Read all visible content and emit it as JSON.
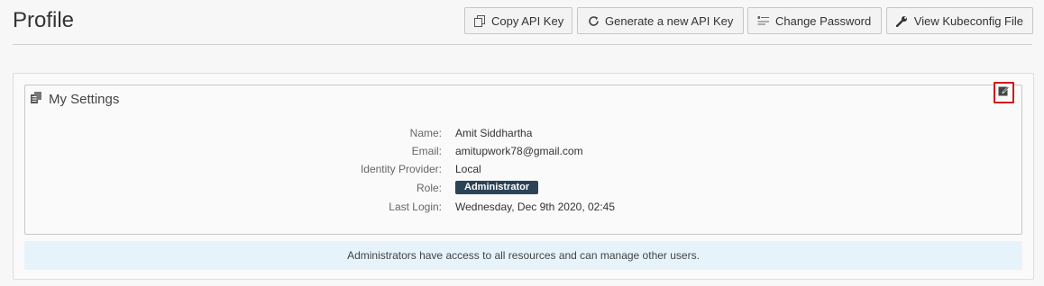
{
  "header": {
    "title": "Profile",
    "buttons": {
      "copy_api_key": "Copy API Key",
      "generate_api_key": "Generate a new API Key",
      "change_password": "Change Password",
      "view_kubeconfig": "View Kubeconfig File"
    }
  },
  "settings": {
    "title": "My Settings",
    "fields": {
      "name_label": "Name:",
      "name_value": "Amit Siddhartha",
      "email_label": "Email:",
      "email_value": "amitupwork78@gmail.com",
      "idp_label": "Identity Provider:",
      "idp_value": "Local",
      "role_label": "Role:",
      "role_value": "Administrator",
      "last_login_label": "Last Login:",
      "last_login_value": "Wednesday, Dec 9th 2020, 02:45"
    },
    "info": "Administrators have access to all resources and can manage other users."
  },
  "colors": {
    "role_badge": "#2c4256",
    "info_bar": "#e6f3fb",
    "edit_highlight": "#d11a1a"
  },
  "icons": {
    "copy": "copy-icon",
    "refresh": "refresh-icon",
    "key": "key-icon",
    "wrench": "wrench-icon",
    "settings": "settings-icon",
    "edit": "edit-icon"
  }
}
